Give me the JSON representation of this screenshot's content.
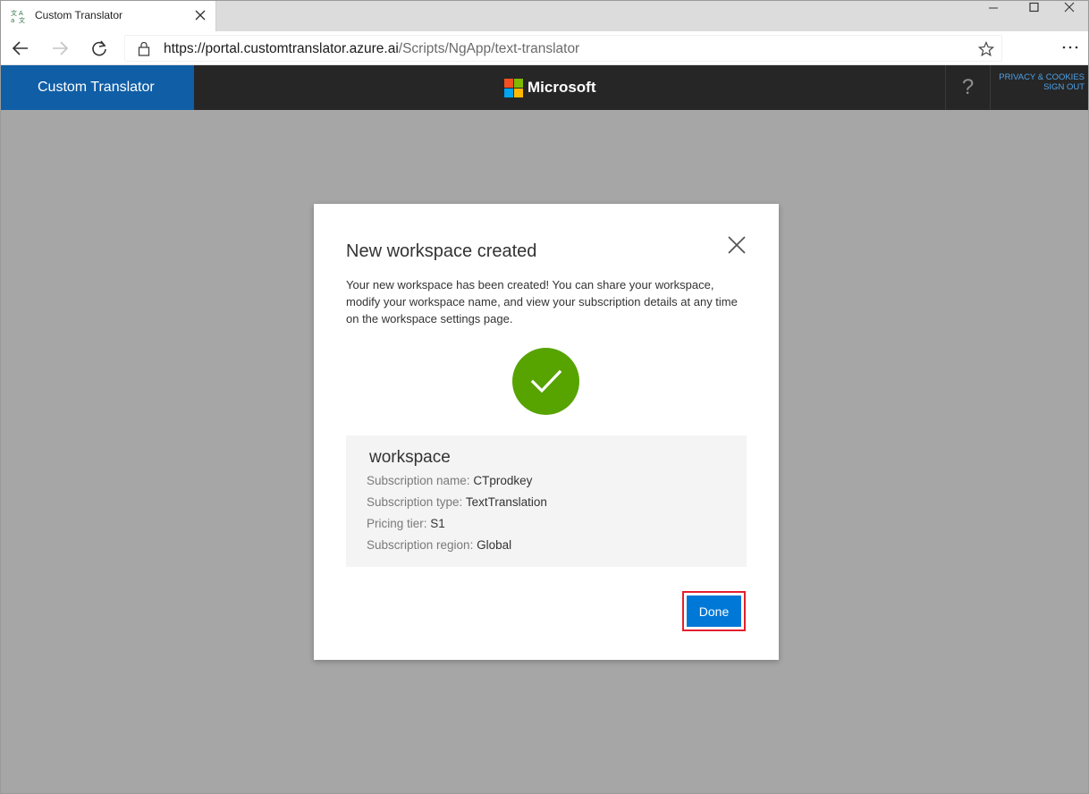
{
  "browser": {
    "tab_title": "Custom Translator",
    "url_main": "https://portal.customtranslator.azure.ai",
    "url_rest": "/Scripts/NgApp/text-translator"
  },
  "header": {
    "brand": "Custom Translator",
    "company": "Microsoft",
    "help": "?",
    "privacy_link": "PRIVACY & COOKIES",
    "signout_link": "SIGN OUT",
    "logo_colors": [
      "#f25022",
      "#7fba00",
      "#00a4ef",
      "#ffb900"
    ]
  },
  "dialog": {
    "title": "New workspace created",
    "body": "Your new workspace has been created! You can share your workspace, modify your workspace name, and view your subscription details at any time on the workspace settings page.",
    "workspace": {
      "name": "workspace",
      "rows": [
        {
          "label": "Subscription name:",
          "value": "CTprodkey"
        },
        {
          "label": "Subscription type:",
          "value": "TextTranslation"
        },
        {
          "label": "Pricing tier:",
          "value": "S1"
        },
        {
          "label": "Subscription region:",
          "value": "Global"
        }
      ]
    },
    "done_label": "Done"
  },
  "colors": {
    "brand_blue": "#105ea6",
    "success_green": "#57a300",
    "primary_button": "#0078d7",
    "highlight_red": "#e4202e"
  }
}
